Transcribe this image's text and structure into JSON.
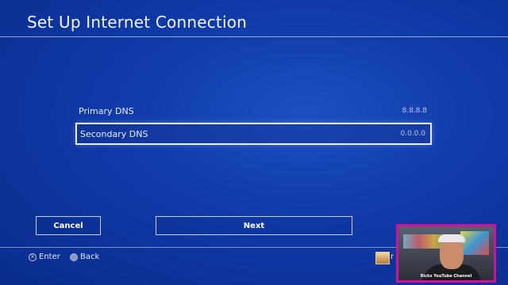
{
  "header": {
    "title": "Set Up Internet Connection"
  },
  "dns": {
    "primary": {
      "label": "Primary DNS",
      "value": "8.8.8.8"
    },
    "secondary": {
      "label": "Secondary DNS",
      "value": "0.0.0.0"
    }
  },
  "buttons": {
    "cancel": "Cancel",
    "next": "Next"
  },
  "footer": {
    "enter_icon": "×",
    "enter_label": "Enter",
    "back_icon": "○",
    "back_label": "Back",
    "user_name": "r"
  },
  "overlay": {
    "caption": "Ricks YouTube Channel"
  },
  "colors": {
    "background": "#0f3aa8",
    "highlight": "#e9eefc",
    "overlay_border": "#d0119a"
  }
}
